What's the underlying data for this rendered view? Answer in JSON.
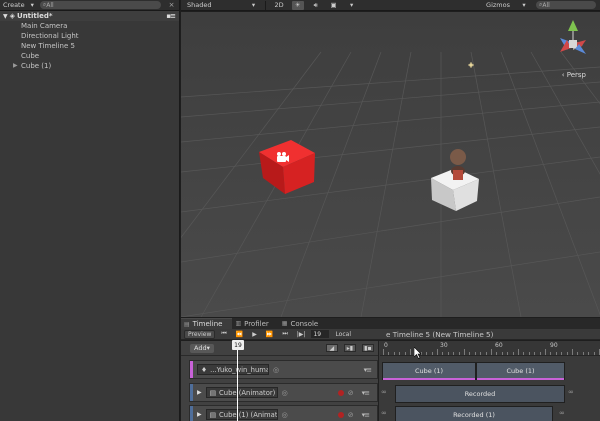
{
  "hierarchy": {
    "create_label": "Create",
    "search_placeholder": "All",
    "scene_name": "Untitled*",
    "items": [
      {
        "label": "Main Camera"
      },
      {
        "label": "Directional Light"
      },
      {
        "label": "New Timeline 5"
      },
      {
        "label": "Cube"
      },
      {
        "label": "Cube (1)"
      }
    ]
  },
  "scene_toolbar": {
    "draw_mode": "Shaded",
    "mode_2d": "2D",
    "gizmos_label": "Gizmos",
    "search_placeholder": "All"
  },
  "scene": {
    "persp_label": "Persp"
  },
  "tabs": [
    {
      "label": "Timeline"
    },
    {
      "label": "Profiler"
    },
    {
      "label": "Console"
    }
  ],
  "timeline": {
    "preview_label": "Preview",
    "frame_value": "19",
    "local_label": "Local",
    "title": "e Timeline 5 (New Timeline 5)",
    "add_label": "Add",
    "playhead_frame": "19",
    "ruler_labels": [
      "0",
      "30",
      "60",
      "90"
    ],
    "tracks": [
      {
        "label": "...Yuko_win_humano",
        "accent": "#c862d8"
      },
      {
        "label": "Cube (Animator)",
        "accent": "#4f6e9a"
      },
      {
        "label": "Cube (1) (Animat",
        "accent": "#4f6e9a"
      }
    ],
    "clips": [
      {
        "label": "Cube (1)"
      },
      {
        "label": "Cube (1)"
      },
      {
        "label": "Recorded"
      },
      {
        "label": "Recorded (1)"
      }
    ]
  }
}
